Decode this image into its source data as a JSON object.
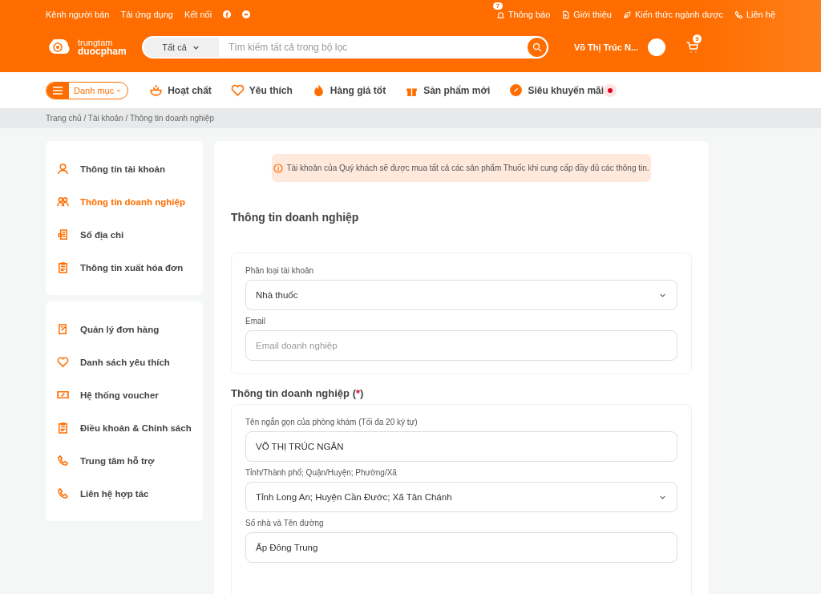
{
  "top_links": [
    "Kênh người bán",
    "Tải ứng dụng",
    "Kết nối"
  ],
  "top_right": [
    {
      "kind": "bell",
      "label": "Thông báo",
      "badge": "7"
    },
    {
      "kind": "doc",
      "label": "Giới thiệu"
    },
    {
      "kind": "leaf",
      "label": "Kiến thức ngành dược"
    },
    {
      "kind": "phone",
      "label": "Liên hệ"
    }
  ],
  "logo": {
    "line1": "trungtam",
    "line2": "duocpham"
  },
  "search": {
    "category": "Tất cả",
    "placeholder": "Tìm kiếm tất cả trong bộ lọc"
  },
  "user": {
    "name": "Võ Thị Trúc N...",
    "cart_count": "9"
  },
  "nav": {
    "menu_label": "Danh mục",
    "items": [
      {
        "kind": "pot",
        "label": "Hoạt chất",
        "live": false
      },
      {
        "kind": "heart",
        "label": "Yêu thích",
        "live": false
      },
      {
        "kind": "fire",
        "label": "Hàng giá tốt",
        "live": false
      },
      {
        "kind": "gift",
        "label": "Sản phẩm mới",
        "live": false
      },
      {
        "kind": "badge",
        "label": "Siêu khuyến mãi",
        "live": true
      }
    ]
  },
  "breadcrumb": "Trang chủ / Tài khoản / Thông tin doanh nghiệp",
  "sidebar": [
    [
      {
        "kind": "user",
        "label": "Thông tin tài khoản",
        "selected": false
      },
      {
        "kind": "group",
        "label": "Thông tin doanh nghiệp",
        "selected": true
      },
      {
        "kind": "book",
        "label": "Sổ địa chỉ",
        "selected": false
      },
      {
        "kind": "clip",
        "label": "Thông tin xuất hóa đơn",
        "selected": false
      }
    ],
    [
      {
        "kind": "order",
        "label": "Quản lý đơn hàng",
        "selected": false
      },
      {
        "kind": "heart",
        "label": "Danh sách yêu thích",
        "selected": false
      },
      {
        "kind": "ticket",
        "label": "Hệ thống voucher",
        "selected": false
      },
      {
        "kind": "clip",
        "label": "Điều khoản & Chính sách",
        "selected": false
      },
      {
        "kind": "phone",
        "label": "Trung tâm hỗ trợ",
        "selected": false
      },
      {
        "kind": "phone",
        "label": "Liên hệ hợp tác",
        "selected": false
      }
    ]
  ],
  "notice": "Tài khoản của Quý khách sẽ được mua tất cả các sản phẩm Thuốc khi cung cấp đầy đủ các thông tin.",
  "heading": "Thông tin doanh nghiệp",
  "account_card": {
    "fields": [
      {
        "kind": "select",
        "label": "Phân loại tài khoản",
        "value": "Nhà thuốc"
      },
      {
        "kind": "text",
        "label": "Email",
        "placeholder": "Email doanh nghiệp"
      }
    ]
  },
  "business_section": {
    "title": "Thông tin doanh nghiệp (",
    "required_mark": "*",
    "title_end": ")",
    "fields": [
      {
        "kind": "text",
        "label": "Tên ngắn gọn của phòng khám (Tối đa 20 ký tự)",
        "value": "VÕ THỊ TRÚC NGÂN"
      },
      {
        "kind": "select",
        "label": "Tỉnh/Thành phố; Quận/Huyện; Phường/Xã",
        "value": "Tỉnh Long An; Huyện Cần Đước; Xã Tân Chánh"
      },
      {
        "kind": "text",
        "label": "Số nhà và Tên đường",
        "value": "Ấp Đông Trung"
      }
    ]
  }
}
